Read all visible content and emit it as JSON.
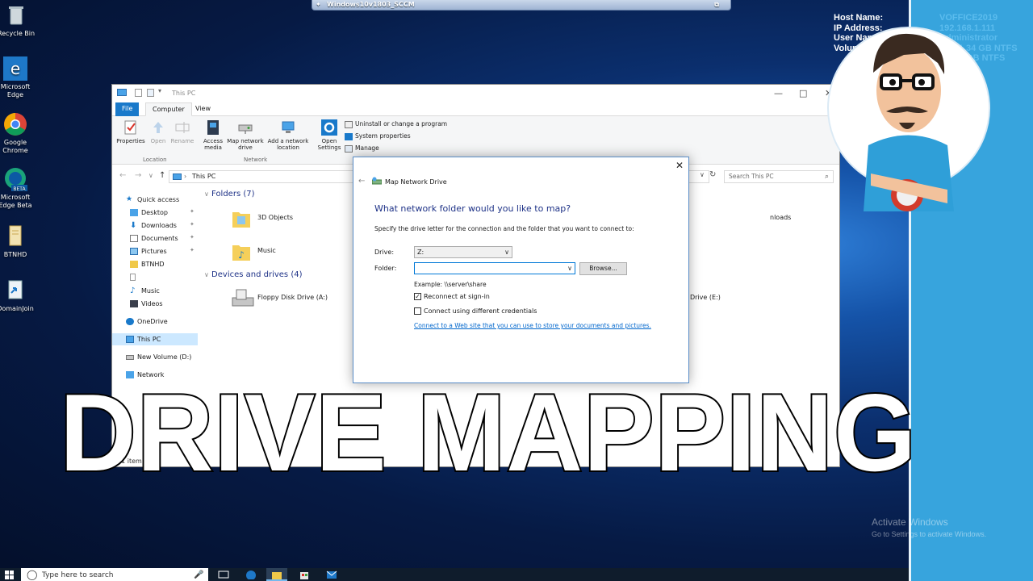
{
  "vm_window": {
    "title": "Windows10v1803_SCCM"
  },
  "desktop_icons": [
    {
      "label": "Recycle Bin"
    },
    {
      "label": "Microsoft Edge"
    },
    {
      "label": "Google Chrome"
    },
    {
      "label": "Microsoft Edge Beta"
    },
    {
      "label": "BTNHD"
    },
    {
      "label": "DomainJoin"
    }
  ],
  "sysinfo": {
    "labels": [
      "Host Name:",
      "IP Address:",
      "User Name:",
      "Volumes:"
    ],
    "values": [
      "VOFFICE2019",
      "192.168.1.111",
      "Administrator",
      "C:\\ 31.34 GB NTFS",
      "D:\\ 98 GB NTFS"
    ]
  },
  "explorer": {
    "title": "This PC",
    "tabs": {
      "file": "File",
      "computer": "Computer",
      "view": "View"
    },
    "ribbon": {
      "properties": "Properties",
      "open": "Open",
      "rename": "Rename",
      "access_media": "Access media",
      "map_network_drive": "Map network drive",
      "add_network_location": "Add a network location",
      "open_settings": "Open Settings",
      "uninstall": "Uninstall or change a program",
      "system_properties": "System properties",
      "manage": "Manage",
      "group_location": "Location",
      "group_network": "Network"
    },
    "address": "This PC",
    "search_placeholder": "Search This PC",
    "nav": [
      {
        "label": "Quick access"
      },
      {
        "label": "Desktop"
      },
      {
        "label": "Downloads"
      },
      {
        "label": "Documents"
      },
      {
        "label": "Pictures"
      },
      {
        "label": "BTNHD"
      },
      {
        "label": ""
      },
      {
        "label": "Music"
      },
      {
        "label": "Videos"
      },
      {
        "label": "OneDrive"
      },
      {
        "label": "This PC"
      },
      {
        "label": "New Volume (D:)"
      },
      {
        "label": "Network"
      }
    ],
    "folders_header": "Folders (7)",
    "folders": [
      "3D Objects",
      "Music",
      "nloads"
    ],
    "drives_header": "Devices and drives (4)",
    "drives": [
      "Floppy Disk Drive (A:)",
      "Drive (E:)"
    ],
    "status": "11 item"
  },
  "dialog": {
    "title": "Map Network Drive",
    "heading": "What network folder would you like to map?",
    "subheading": "Specify the drive letter for the connection and the folder that you want to connect to:",
    "drive_label": "Drive:",
    "drive_value": "Z:",
    "folder_label": "Folder:",
    "folder_value": "",
    "browse_label": "Browse...",
    "example": "Example: \\\\server\\share",
    "reconnect_label": "Reconnect at sign-in",
    "reconnect_checked": true,
    "credentials_label": "Connect using different credentials",
    "credentials_checked": false,
    "link": "Connect to a Web site that you can use to store your documents and pictures."
  },
  "overlay_text": "DRIVE MAPPING",
  "watermark": {
    "line1": "Activate Windows",
    "line2": "Go to Settings to activate Windows."
  },
  "taskbar": {
    "search_placeholder": "Type here to search"
  },
  "colors": {
    "accent": "#0078d7",
    "panel": "#37a4dd",
    "link": "#0066cc",
    "heading": "#1e3287"
  }
}
